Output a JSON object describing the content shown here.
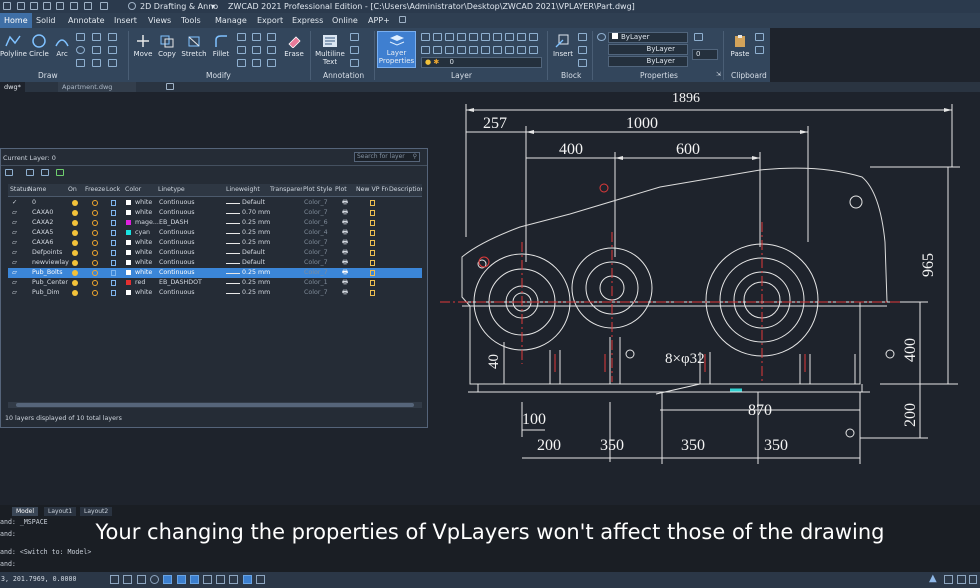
{
  "window": {
    "workspace": "2D Drafting & Anno",
    "title": "ZWCAD 2021 Professional Edition - [C:\\Users\\Administrator\\Desktop\\ZWCAD 2021\\VPLAYER\\Part.dwg]"
  },
  "menus": [
    "Home",
    "Solid",
    "Annotate",
    "Insert",
    "Views",
    "Tools",
    "Manage",
    "Export",
    "Express",
    "Online",
    "APP+"
  ],
  "ribbon": {
    "draw": {
      "group": "Draw",
      "buttons": [
        "Polyline",
        "Circle",
        "Arc"
      ]
    },
    "modify": {
      "group": "Modify",
      "buttons": [
        "Move",
        "Copy",
        "Stretch",
        "Fillet",
        "Erase"
      ]
    },
    "annotation": {
      "group": "Annotation",
      "mtext": "Multiline Text"
    },
    "layer": {
      "group": "Layer",
      "button": "Layer Properties",
      "current": "0"
    },
    "block": {
      "group": "Block",
      "button": "Insert"
    },
    "properties": {
      "group": "Properties",
      "color": "ByLayer",
      "linetype": "ByLayer",
      "lineweight": "ByLayer",
      "value": "0"
    },
    "clipboard": {
      "group": "Clipboard",
      "button": "Paste"
    }
  },
  "doctabs": [
    "dwg*",
    "Apartment.dwg"
  ],
  "layer_dialog": {
    "current_layer_label": "Current Layer: 0",
    "search_placeholder": "Search for layer",
    "columns": [
      "Status",
      "Name",
      "On",
      "Freeze",
      "Lock",
      "Color",
      "Linetype",
      "Lineweight",
      "Transparency",
      "Plot Style",
      "Plot",
      "New VP Freeze",
      "Description"
    ],
    "rows": [
      {
        "name": "0",
        "color": "white",
        "swatch": "#ffffff",
        "linetype": "Continuous",
        "lineweight": "Default",
        "plotstyle": "Color_7",
        "current": true
      },
      {
        "name": "CAXA0",
        "color": "white",
        "swatch": "#ffffff",
        "linetype": "Continuous",
        "lineweight": "0.70 mm",
        "plotstyle": "Color_7"
      },
      {
        "name": "CAXA2",
        "color": "mage...",
        "swatch": "#e021e0",
        "linetype": "EB_DASH",
        "lineweight": "0.25 mm",
        "plotstyle": "Color_6"
      },
      {
        "name": "CAXA5",
        "color": "cyan",
        "swatch": "#19e2e2",
        "linetype": "Continuous",
        "lineweight": "0.25 mm",
        "plotstyle": "Color_4"
      },
      {
        "name": "CAXA6",
        "color": "white",
        "swatch": "#ffffff",
        "linetype": "Continuous",
        "lineweight": "0.25 mm",
        "plotstyle": "Color_7"
      },
      {
        "name": "Defpoints",
        "color": "white",
        "swatch": "#ffffff",
        "linetype": "Continuous",
        "lineweight": "Default",
        "plotstyle": "Color_7"
      },
      {
        "name": "newviewlay",
        "color": "white",
        "swatch": "#ffffff",
        "linetype": "Continuous",
        "lineweight": "Default",
        "plotstyle": "Color_7"
      },
      {
        "name": "Pub_Bolts",
        "color": "white",
        "swatch": "#ffffff",
        "linetype": "Continuous",
        "lineweight": "0.25 mm",
        "plotstyle": "Color_7",
        "selected": true
      },
      {
        "name": "Pub_Center",
        "color": "red",
        "swatch": "#e53030",
        "linetype": "EB_DASHDOT",
        "lineweight": "0.25 mm",
        "plotstyle": "Color_1"
      },
      {
        "name": "Pub_Dim",
        "color": "white",
        "swatch": "#ffffff",
        "linetype": "Continuous",
        "lineweight": "0.25 mm",
        "plotstyle": "Color_7"
      }
    ],
    "footer": "10 layers displayed of 10 total layers"
  },
  "dimensions": {
    "d1896": "1896",
    "d257": "257",
    "d1000": "1000",
    "d400": "400",
    "d600": "600",
    "d965": "965",
    "d400v": "400",
    "d40": "40",
    "d100": "100",
    "d870": "870",
    "d200v": "200",
    "d200": "200",
    "d350a": "350",
    "d350b": "350",
    "d350c": "350",
    "holes": "8×φ32"
  },
  "layout_tabs": [
    "Model",
    "Layout1",
    "Layout2"
  ],
  "command_lines": [
    "and: _MSPACE",
    "and:",
    "and: <Switch to: Model>",
    "and:"
  ],
  "subtitle": "Your changing the properties of VpLayers won't affect those of the drawing",
  "coords": "3, 201.7969, 0.0000"
}
